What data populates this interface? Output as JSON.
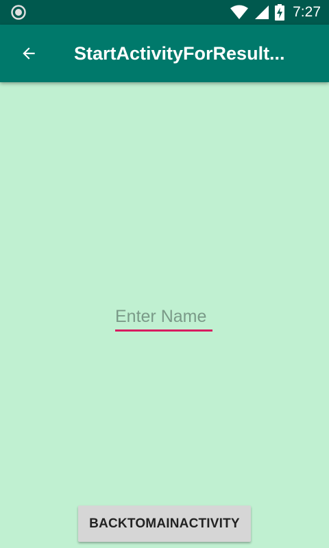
{
  "status_bar": {
    "time": "7:27",
    "icons": [
      "record-icon",
      "wifi-icon",
      "cell-signal-icon",
      "battery-charging-icon"
    ]
  },
  "app_bar": {
    "title": "StartActivityForResult...",
    "back_icon": "arrow-back-icon"
  },
  "form": {
    "name_input": {
      "value": "",
      "placeholder": "Enter Name"
    }
  },
  "actions": {
    "back_to_main_label": "BACKTOMAINACTIVITY"
  },
  "colors": {
    "status_bar": "#00594e",
    "app_bar": "#00796b",
    "background": "#c0f0d1",
    "accent": "#d81b60",
    "button": "#d6d6d6"
  }
}
